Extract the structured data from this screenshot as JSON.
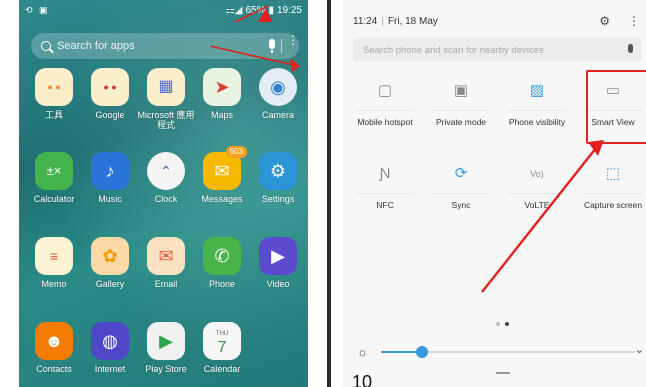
{
  "left_phone": {
    "status": {
      "left_icons": "⟲ ▣",
      "signal": "⚏◢",
      "battery_pct": "65%",
      "time": "19:25"
    },
    "search_placeholder": "Search for apps",
    "apps": [
      {
        "name": "工具",
        "icon": "tools-folder-icon",
        "glyph": "▪▫"
      },
      {
        "name": "Google",
        "icon": "google-folder-icon",
        "glyph": "▪▫"
      },
      {
        "name": "Microsoft 應用程式",
        "icon": "microsoft-folder-icon",
        "glyph": "▦"
      },
      {
        "name": "Maps",
        "icon": "maps-icon",
        "glyph": "➤"
      },
      {
        "name": "Camera",
        "icon": "camera-icon",
        "glyph": "◉"
      },
      {
        "name": "Calculator",
        "icon": "calculator-icon",
        "glyph": "±"
      },
      {
        "name": "Music",
        "icon": "music-icon",
        "glyph": "♪"
      },
      {
        "name": "Clock",
        "icon": "clock-icon",
        "glyph": "⌃"
      },
      {
        "name": "Messages",
        "icon": "messages-icon",
        "glyph": "✉",
        "badge": "503"
      },
      {
        "name": "Settings",
        "icon": "settings-gear-icon",
        "glyph": "⚙"
      },
      {
        "name": "Memo",
        "icon": "memo-icon",
        "glyph": "≡"
      },
      {
        "name": "Gallery",
        "icon": "gallery-icon",
        "glyph": "✿"
      },
      {
        "name": "Email",
        "icon": "email-icon",
        "glyph": "✉"
      },
      {
        "name": "Phone",
        "icon": "phone-icon",
        "glyph": "✆"
      },
      {
        "name": "Video",
        "icon": "video-icon",
        "glyph": "▶"
      },
      {
        "name": "Contacts",
        "icon": "contacts-icon",
        "glyph": "☻"
      },
      {
        "name": "Internet",
        "icon": "internet-icon",
        "glyph": "◍"
      },
      {
        "name": "Play Store",
        "icon": "play-store-icon",
        "glyph": "▶"
      },
      {
        "name": "Calendar",
        "icon": "calendar-icon",
        "glyph": "7",
        "sub": "THU"
      }
    ]
  },
  "right_phone": {
    "time": "11:24",
    "date": "Fri, 18 May",
    "search_placeholder": "Search phone and scan for nearby devices",
    "tiles": [
      {
        "label": "Mobile hotspot",
        "icon": "mobile-hotspot-icon",
        "glyph": "▢"
      },
      {
        "label": "Private mode",
        "icon": "private-mode-icon",
        "glyph": "▣"
      },
      {
        "label": "Phone visibility",
        "icon": "phone-visibility-icon",
        "glyph": "▨"
      },
      {
        "label": "Smart View",
        "icon": "smart-view-icon",
        "glyph": "▭"
      },
      {
        "label": "NFC",
        "icon": "nfc-icon",
        "glyph": "Ɲ"
      },
      {
        "label": "Sync",
        "icon": "sync-icon",
        "glyph": "⟳"
      },
      {
        "label": "VoLTE",
        "icon": "volte-icon",
        "glyph": "Vo)"
      },
      {
        "label": "Capture screen",
        "icon": "capture-screen-icon",
        "glyph": "⬚"
      }
    ],
    "brightness_level": 0.16
  },
  "page_number": "10",
  "colors": {
    "highlight": "#e12020",
    "accent": "#3a9ad9"
  }
}
